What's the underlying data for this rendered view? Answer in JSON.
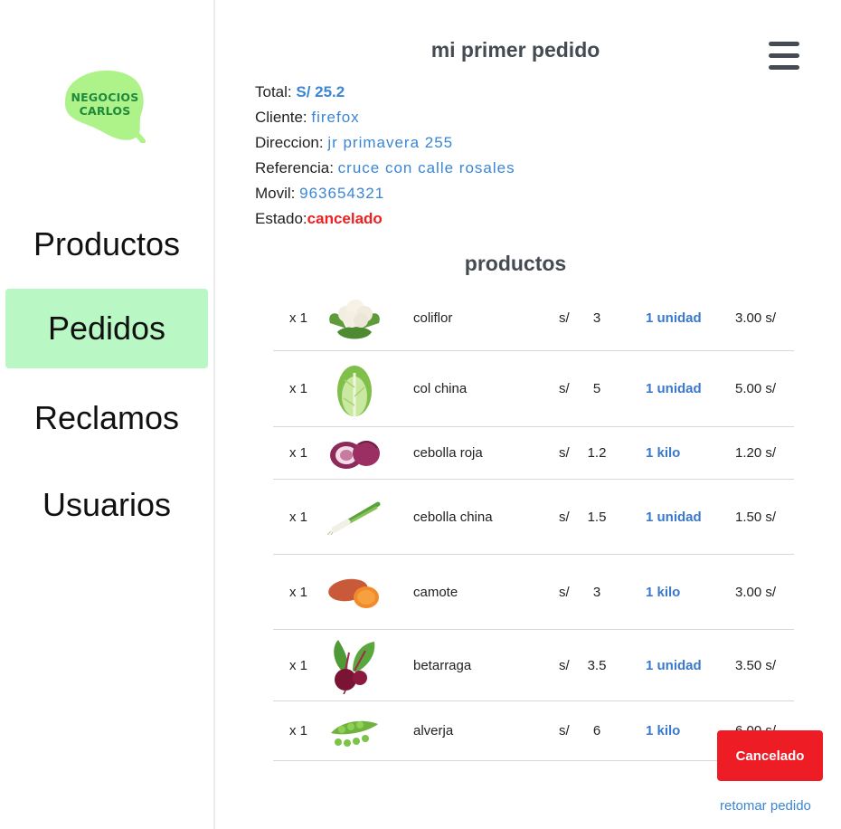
{
  "brand": {
    "line1": "NEGOCIOS",
    "line2": "CARLOS",
    "color": "#1f8a3a",
    "splash_color": "#aef28a"
  },
  "sidebar": {
    "items": [
      {
        "label": "Productos",
        "active": false
      },
      {
        "label": "Pedidos",
        "active": true
      },
      {
        "label": "Reclamos",
        "active": false
      },
      {
        "label": "Usuarios",
        "active": false
      }
    ],
    "active_color": "#b9f7c4"
  },
  "order": {
    "title": "mi primer pedido",
    "total_label": "Total: ",
    "total_value": "S/ 25.2",
    "client_label": "Cliente: ",
    "client_value": "firefox",
    "address_label": "Direccion: ",
    "address_value": "jr primavera 255",
    "reference_label": "Referencia: ",
    "reference_value": "cruce con calle rosales",
    "phone_label": "Movil: ",
    "phone_value": "963654321",
    "status_label": "Estado:",
    "status_value": "cancelado",
    "status_color": "#ee2020"
  },
  "products_title": "productos",
  "products": [
    {
      "qty": "x 1",
      "name": "coliflor",
      "currency": "s/",
      "price": "3",
      "unit": "1 unidad",
      "subtotal": "3.00 s/",
      "icon": "cauliflower-icon"
    },
    {
      "qty": "x 1",
      "name": "col china",
      "currency": "s/",
      "price": "5",
      "unit": "1 unidad",
      "subtotal": "5.00 s/",
      "icon": "chinese-cabbage-icon"
    },
    {
      "qty": "x 1",
      "name": "cebolla roja",
      "currency": "s/",
      "price": "1.2",
      "unit": "1 kilo",
      "subtotal": "1.20 s/",
      "icon": "red-onion-icon"
    },
    {
      "qty": "x 1",
      "name": "cebolla china",
      "currency": "s/",
      "price": "1.5",
      "unit": "1 unidad",
      "subtotal": "1.50 s/",
      "icon": "spring-onion-icon"
    },
    {
      "qty": "x 1",
      "name": "camote",
      "currency": "s/",
      "price": "3",
      "unit": "1 kilo",
      "subtotal": "3.00 s/",
      "icon": "sweet-potato-icon"
    },
    {
      "qty": "x 1",
      "name": "betarraga",
      "currency": "s/",
      "price": "3.5",
      "unit": "1 unidad",
      "subtotal": "3.50 s/",
      "icon": "beetroot-icon"
    },
    {
      "qty": "x 1",
      "name": "alverja",
      "currency": "s/",
      "price": "6",
      "unit": "1 kilo",
      "subtotal": "6.00 s/",
      "icon": "peas-icon"
    }
  ],
  "actions": {
    "cancel_label": "Cancelado",
    "cancel_color": "#ee1c24",
    "resume_label": "retomar pedido"
  }
}
